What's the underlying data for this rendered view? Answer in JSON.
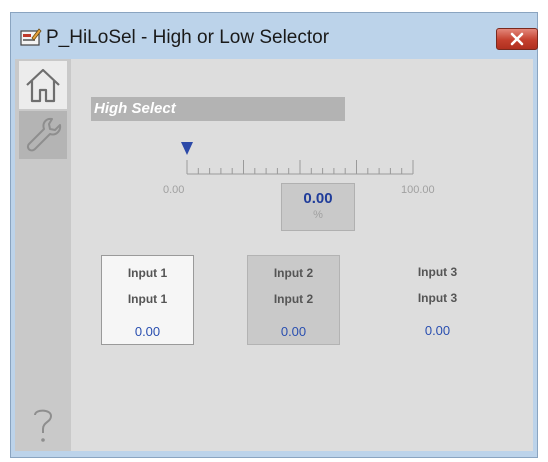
{
  "window": {
    "title": "P_HiLoSel - High or Low Selector"
  },
  "nav": {
    "home": "home-icon",
    "maintenance": "wrench-icon",
    "help": "help-icon"
  },
  "main": {
    "mode_label": "High Select",
    "scale": {
      "min": "0.00",
      "max": "100.00",
      "indicator_fraction": 0.0
    },
    "pv": {
      "value": "0.00",
      "unit": "%"
    },
    "inputs": [
      {
        "name": "Input 1",
        "label": "Input 1",
        "value": "0.00",
        "state": "selected"
      },
      {
        "name": "Input 2",
        "label": "Input 2",
        "value": "0.00",
        "state": "shaded"
      },
      {
        "name": "Input 3",
        "label": "Input 3",
        "value": "0.00",
        "state": "plain"
      }
    ]
  },
  "colors": {
    "window_frame": "#bcd3ea",
    "value_blue": "#2a4fb0",
    "close_red": "#c4402e"
  }
}
